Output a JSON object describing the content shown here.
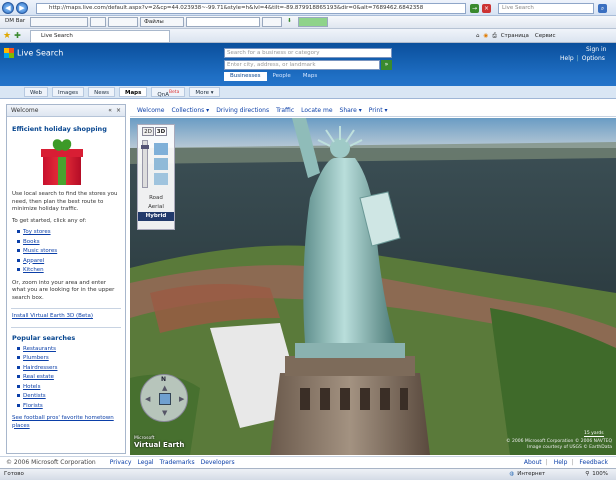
{
  "browser": {
    "url": "http://maps.live.com/default.aspx?v=2&cp=44.023938~-99.71&style=h&lvl=4&tilt=-89.879918865193&dir=0&alt=7689462.6842358",
    "search_placeholder": "Live Search",
    "toolbar_label": "DM Bar",
    "files_label": "Файлы",
    "tab_title": "Live Search",
    "page_menu": "Страница",
    "service_menu": "Сервис"
  },
  "header": {
    "logo": "Live Search",
    "business_placeholder": "Search for a business or category",
    "city_placeholder": "Enter city, address, or landmark",
    "go": "»",
    "scopes": [
      "Businesses",
      "People",
      "Maps"
    ],
    "sign_in": "Sign in",
    "help": "Help",
    "options": "Options"
  },
  "vertical_tabs": [
    {
      "label": "Web"
    },
    {
      "label": "Images"
    },
    {
      "label": "News"
    },
    {
      "label": "Maps"
    },
    {
      "label": "QnA"
    },
    {
      "label": "More ▾"
    }
  ],
  "qna_badge": "Beta",
  "panel": {
    "title": "Welcome",
    "collapse": "«",
    "close": "×",
    "heading": "Efficient holiday shopping",
    "intro": "Use local search to find the stores you need, then plan the best route to minimize holiday traffic.",
    "get_started": "To get started, click any of:",
    "stores": [
      "Toy stores",
      "Books",
      "Music stores",
      "Apparel",
      "Kitchen"
    ],
    "zoom_text": "Or, zoom into your area and enter what you are looking for in the upper search box.",
    "install_link": "Install Virtual Earth 3D (Beta)",
    "popular_heading": "Popular searches",
    "popular": [
      "Restaurants",
      "Plumbers",
      "Hairdressers",
      "Real estate",
      "Hotels",
      "Dentists",
      "Florists"
    ],
    "football_link": "See football pros' favorite hometown places"
  },
  "map_toolbar": [
    "Welcome",
    "Collections ▾",
    "Driving directions",
    "Traffic",
    "Locate me",
    "Share ▾",
    "Print ▾"
  ],
  "map_controls": {
    "dim2d": "2D",
    "dim3d": "3D",
    "styles": [
      "Road",
      "Aerial",
      "Hybrid"
    ],
    "compass_n": "N"
  },
  "map_overlay": {
    "logo": "Virtual Earth",
    "logo_prefix": "Microsoft",
    "copyright": "© 2006 Microsoft Corporation  © 2006 NAVTEQ",
    "imagery": "Image courtesy of USGS  © EarthData",
    "scale": "15 yards"
  },
  "footer": {
    "copyright": "© 2006 Microsoft Corporation",
    "links": [
      "Privacy",
      "Legal",
      "Trademarks",
      "Developers"
    ],
    "right_links": [
      "About",
      "Help",
      "Feedback"
    ]
  },
  "status": {
    "left": "Готово",
    "zone": "Интернет",
    "zoom": "100%"
  }
}
